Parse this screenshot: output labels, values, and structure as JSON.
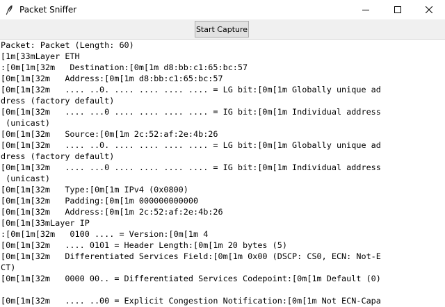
{
  "window": {
    "title": "Packet Sniffer",
    "controls": [
      "minimize-icon",
      "maximize-icon",
      "close-icon"
    ],
    "icon": "feather-icon"
  },
  "toolbar": {
    "start_capture_label": "Start Capture"
  },
  "output": {
    "lines": [
      "Packet: Packet (Length: 60)",
      "\u001b[1m\u001b[33mLayer ETH",
      ":\u001b[0m\u001b[1m\u001b[32m   Destination:\u001b[0m\u001b[1m d8:bb:c1:65:bc:57",
      "\u001b[0m\u001b[1m\u001b[32m   Address:\u001b[0m\u001b[1m d8:bb:c1:65:bc:57",
      "\u001b[0m\u001b[1m\u001b[32m   .... ..0. .... .... .... .... = LG bit:\u001b[0m\u001b[1m Globally unique ad",
      "dress (factory default)",
      "\u001b[0m\u001b[1m\u001b[32m   .... ...0 .... .... .... .... = IG bit:\u001b[0m\u001b[1m Individual address",
      " (unicast)",
      "\u001b[0m\u001b[1m\u001b[32m   Source:\u001b[0m\u001b[1m 2c:52:af:2e:4b:26",
      "\u001b[0m\u001b[1m\u001b[32m   .... ..0. .... .... .... .... = LG bit:\u001b[0m\u001b[1m Globally unique ad",
      "dress (factory default)",
      "\u001b[0m\u001b[1m\u001b[32m   .... ...0 .... .... .... .... = IG bit:\u001b[0m\u001b[1m Individual address",
      " (unicast)",
      "\u001b[0m\u001b[1m\u001b[32m   Type:\u001b[0m\u001b[1m IPv4 (0x0800)",
      "\u001b[0m\u001b[1m\u001b[32m   Padding:\u001b[0m\u001b[1m 000000000000",
      "\u001b[0m\u001b[1m\u001b[32m   Address:\u001b[0m\u001b[1m 2c:52:af:2e:4b:26",
      "\u001b[0m\u001b[1m\u001b[33mLayer IP",
      ":\u001b[0m\u001b[1m\u001b[32m   0100 .... = Version:\u001b[0m\u001b[1m 4",
      "\u001b[0m\u001b[1m\u001b[32m   .... 0101 = Header Length:\u001b[0m\u001b[1m 20 bytes (5)",
      "\u001b[0m\u001b[1m\u001b[32m   Differentiated Services Field:\u001b[0m\u001b[1m 0x00 (DSCP: CS0, ECN: Not-E",
      "CT)",
      "\u001b[0m\u001b[1m\u001b[32m   0000 00.. = Differentiated Services Codepoint:\u001b[0m\u001b[1m Default (0)",
      "",
      "\u001b[0m\u001b[1m\u001b[32m   .... ..00 = Explicit Congestion Notification:\u001b[0m\u001b[1m Not ECN-Capa"
    ]
  }
}
